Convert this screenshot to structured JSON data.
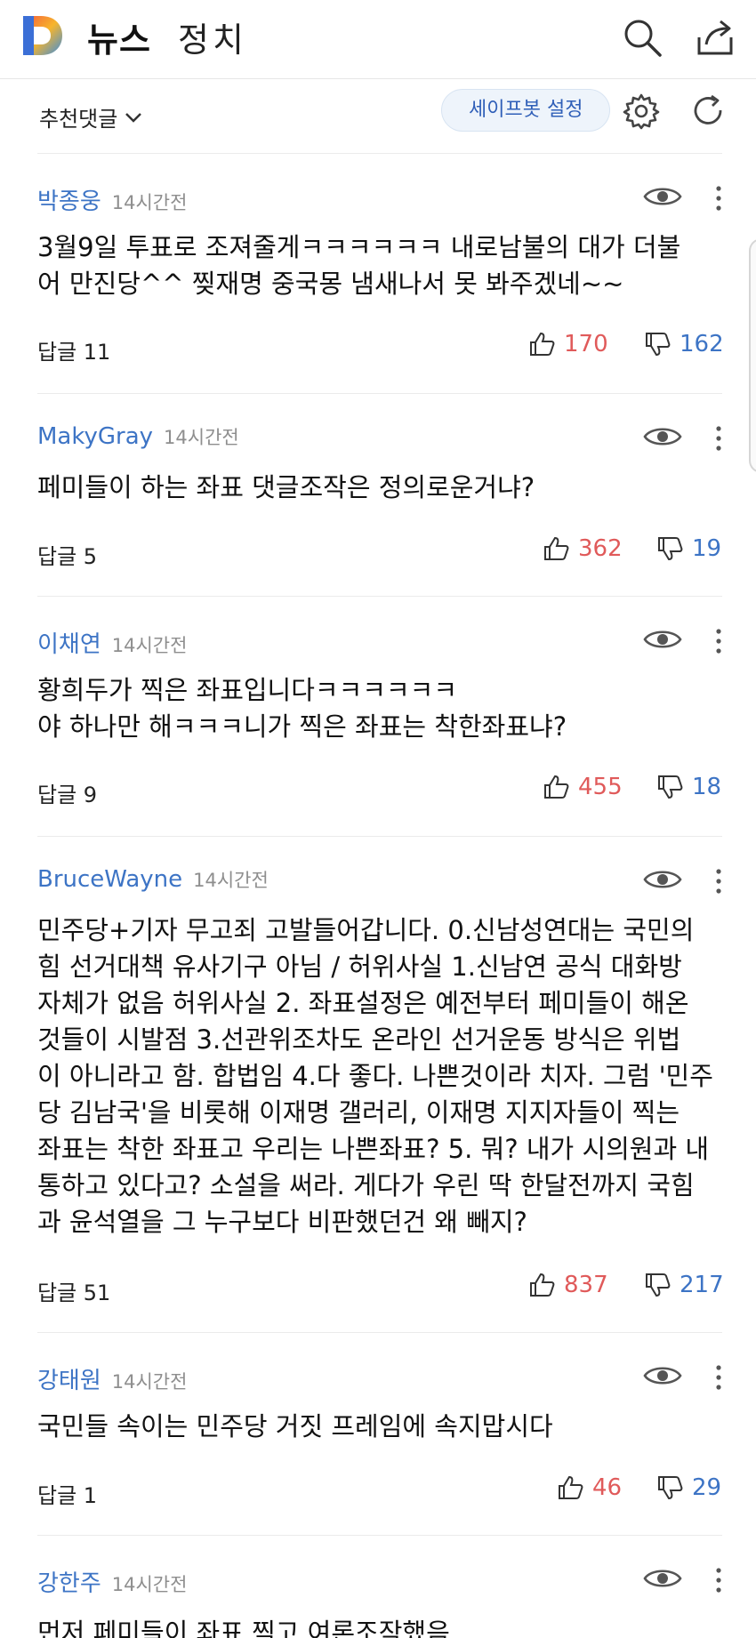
{
  "header": {
    "section": "뉴스",
    "category": "정치"
  },
  "toolbar": {
    "sort_label": "추천댓글",
    "safebot_label": "세이프봇 설정"
  },
  "comments": [
    {
      "author": "박종웅",
      "time": "14시간전",
      "text": "3월9일 투표로 조져줄게ㅋㅋㅋㅋㅋㅋ 내로남불의 대가 더불\n어 만진당^^ 찢재명 중국몽 냄새나서 못 봐주겠네~~",
      "replies": "답글 11",
      "likes": "170",
      "dislikes": "162"
    },
    {
      "author": "MakyGray",
      "time": "14시간전",
      "text": "페미들이 하는 좌표 댓글조작은 정의로운거냐?",
      "replies": "답글 5",
      "likes": "362",
      "dislikes": "19"
    },
    {
      "author": "이채연",
      "time": "14시간전",
      "text": "황희두가 찍은 좌표입니다ㅋㅋㅋㅋㅋㅋ\n야 하나만 해ㅋㅋㅋ니가 찍은 좌표는 착한좌표냐?",
      "replies": "답글 9",
      "likes": "455",
      "dislikes": "18"
    },
    {
      "author": "BruceWayne",
      "time": "14시간전",
      "text": "민주당+기자 무고죄 고발들어갑니다. 0.신남성연대는 국민의\n힘 선거대책 유사기구 아님 / 허위사실 1.신남연 공식 대화방\n자체가 없음 허위사실 2. 좌표설정은 예전부터 페미들이 해온\n것들이 시발점 3.선관위조차도 온라인 선거운동 방식은 위법\n이 아니라고 함. 합법임 4.다 좋다. 나쁜것이라 치자. 그럼 '민주\n당 김남국'을 비롯해 이재명 갤러리, 이재명 지지자들이 찍는\n좌표는 착한 좌표고 우리는 나쁜좌표? 5. 뭐? 내가 시의원과 내\n통하고 있다고? 소설을 써라. 게다가 우린 딱 한달전까지 국힘\n과 윤석열을 그 누구보다 비판했던건 왜 빼지?",
      "replies": "답글 51",
      "likes": "837",
      "dislikes": "217"
    },
    {
      "author": "강태원",
      "time": "14시간전",
      "text": "국민들 속이는 민주당 거짓 프레임에 속지맙시다",
      "replies": "답글 1",
      "likes": "46",
      "dislikes": "29"
    },
    {
      "author": "강한주",
      "time": "14시간전",
      "text": "먼저 페미들이 좌표 찍고 여론조작했음"
    }
  ],
  "colors": {
    "author": "#3d74c5",
    "like": "#e05a5a",
    "dislike": "#3d74c5"
  }
}
